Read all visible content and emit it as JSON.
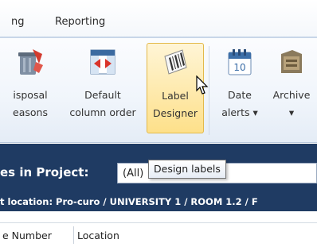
{
  "menu": {
    "tabs": [
      "ng",
      "Reporting"
    ]
  },
  "ribbon": {
    "buttons": [
      {
        "id": "disposal-reasons",
        "line1": "isposal",
        "line2": "easons"
      },
      {
        "id": "default-column-order",
        "line1": "Default",
        "line2": "column order"
      },
      {
        "id": "label-designer",
        "line1": "Label",
        "line2": "Designer"
      },
      {
        "id": "date-alerts",
        "line1": "Date",
        "line2": "alerts ▾"
      },
      {
        "id": "archive",
        "line1": "Archive",
        "line2": "▾"
      }
    ]
  },
  "tooltip": {
    "text": "Design labels"
  },
  "project": {
    "title": "es in Project:",
    "filter_value": "(All)",
    "location": "t location: Pro-curo / UNIVERSITY 1 / ROOM 1.2 / F"
  },
  "grid": {
    "columns": [
      "e Number",
      "Location"
    ]
  },
  "colors": {
    "ribbon_bg": "#eef3f9",
    "highlight": "#fde08a",
    "project_bar": "#1f3b63"
  }
}
